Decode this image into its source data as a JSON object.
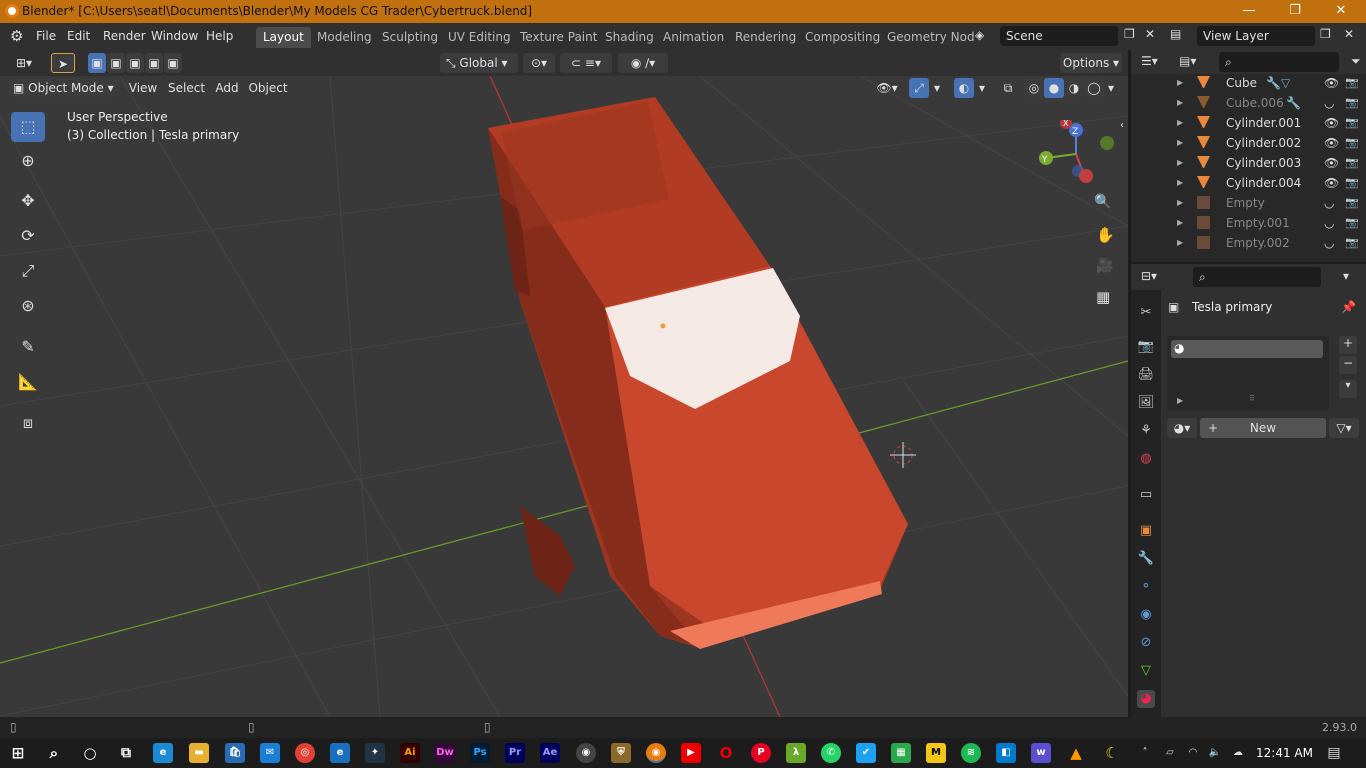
{
  "window": {
    "title": "Blender* [C:\\Users\\seatl\\Documents\\Blender\\My Models CG Trader\\Cybertruck.blend]",
    "minimize": "—",
    "maximize": "❐",
    "close": "✕"
  },
  "menu": [
    "File",
    "Edit",
    "Render",
    "Window",
    "Help"
  ],
  "workspaces": [
    "Layout",
    "Modeling",
    "Sculpting",
    "UV Editing",
    "Texture Paint",
    "Shading",
    "Animation",
    "Rendering",
    "Compositing",
    "Geometry Nod"
  ],
  "scene": {
    "name": "Scene",
    "view_layer": "View Layer"
  },
  "viewport": {
    "transform_orientation": "Global",
    "options": "Options",
    "mode": "Object Mode",
    "header_menu": [
      "View",
      "Select",
      "Add",
      "Object"
    ],
    "perspective": "User Perspective",
    "collection_info": "(3) Collection | Tesla primary",
    "axes": {
      "x": "X",
      "y": "Y",
      "z": "Z"
    }
  },
  "outliner": {
    "search_placeholder": "",
    "items": [
      {
        "name": "Cube",
        "type": "mesh",
        "visible": true
      },
      {
        "name": "Cube.006",
        "type": "mesh",
        "visible": false
      },
      {
        "name": "Cylinder.001",
        "type": "mesh",
        "visible": true
      },
      {
        "name": "Cylinder.002",
        "type": "mesh",
        "visible": true
      },
      {
        "name": "Cylinder.003",
        "type": "mesh",
        "visible": true
      },
      {
        "name": "Cylinder.004",
        "type": "mesh",
        "visible": true
      },
      {
        "name": "Empty",
        "type": "empty",
        "visible": false
      },
      {
        "name": "Empty.001",
        "type": "empty",
        "visible": false
      },
      {
        "name": "Empty.002",
        "type": "empty",
        "visible": false
      }
    ]
  },
  "properties": {
    "object_name": "Tesla primary",
    "new_button": "New"
  },
  "status": {
    "version": "2.93.0"
  },
  "taskbar": {
    "time": "12:41 AM",
    "apps": [
      "Ai",
      "Dw",
      "Ps",
      "Pr",
      "Ae"
    ]
  },
  "colors": {
    "accent": "#4772b3",
    "title_bar": "#c0700f",
    "truck": "#c6432a",
    "x_axis": "#c73a3a",
    "y_axis": "#6a9a2a"
  }
}
